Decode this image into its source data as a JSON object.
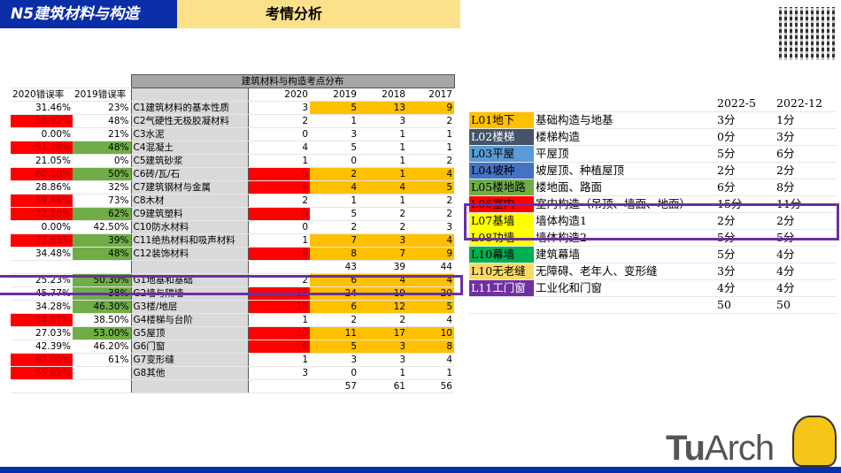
{
  "header": {
    "course": "N5建筑材料与构造",
    "section": "考情分析"
  },
  "logo": "TuArch",
  "left_table": {
    "title": "建筑材料与构造考点分布",
    "rate_headers": [
      "2020错误率",
      "2019错误率"
    ],
    "years": [
      "2020",
      "2019",
      "2018",
      "2017"
    ],
    "rows": [
      {
        "r2020": "31.46%",
        "r2020c": "",
        "r2019": "23%",
        "r2019c": "",
        "name": "C1建筑材料的基本性质",
        "v": [
          "3",
          "5",
          "13",
          "9"
        ],
        "vc": [
          "",
          "org",
          "org",
          "org"
        ]
      },
      {
        "r2020": "58.92%",
        "r2020c": "red",
        "r2019": "48%",
        "r2019c": "",
        "name": "C2气硬性无极胶凝材料",
        "v": [
          "2",
          "1",
          "3",
          "2"
        ],
        "vc": [
          "",
          "",
          "",
          ""
        ]
      },
      {
        "r2020": "0.00%",
        "r2020c": "",
        "r2019": "21%",
        "r2019c": "",
        "name": "C3水泥",
        "v": [
          "0",
          "3",
          "1",
          "1"
        ],
        "vc": [
          "",
          "",
          "",
          ""
        ]
      },
      {
        "r2020": "51.20%",
        "r2020c": "red",
        "r2019": "48%",
        "r2019c": "grn",
        "name": "C4混凝土",
        "v": [
          "4",
          "5",
          "1",
          "1"
        ],
        "vc": [
          "",
          "",
          "",
          ""
        ]
      },
      {
        "r2020": "21.05%",
        "r2020c": "",
        "r2019": "0%",
        "r2019c": "",
        "name": "C5建筑砂浆",
        "v": [
          "1",
          "0",
          "1",
          "2"
        ],
        "vc": [
          "",
          "",
          "",
          ""
        ]
      },
      {
        "r2020": "60.10%",
        "r2020c": "red",
        "r2019": "50%",
        "r2019c": "grn",
        "name": "C6砖/瓦/石",
        "v": [
          "5",
          "2",
          "1",
          "4"
        ],
        "vc": [
          "red",
          "org",
          "org",
          "org"
        ]
      },
      {
        "r2020": "28.86%",
        "r2020c": "",
        "r2019": "32%",
        "r2019c": "",
        "name": "C7建筑钢材与金属",
        "v": [
          "6",
          "4",
          "4",
          "5"
        ],
        "vc": [
          "red",
          "org",
          "org",
          "org"
        ]
      },
      {
        "r2020": "59.46%",
        "r2020c": "red",
        "r2019": "73%",
        "r2019c": "",
        "name": "C8木材",
        "v": [
          "2",
          "1",
          "1",
          "2"
        ],
        "vc": [
          "",
          "",
          "",
          ""
        ]
      },
      {
        "r2020": "72.10%",
        "r2020c": "red",
        "r2019": "62%",
        "r2019c": "grn",
        "name": "C9建筑塑料",
        "v": [
          "5",
          "5",
          "2",
          "2"
        ],
        "vc": [
          "red",
          "",
          "",
          ""
        ]
      },
      {
        "r2020": "0.00%",
        "r2020c": "",
        "r2019": "42.50%",
        "r2019c": "",
        "name": "C10防水材料",
        "v": [
          "0",
          "2",
          "2",
          "3"
        ],
        "vc": [
          "",
          "",
          "",
          ""
        ]
      },
      {
        "r2020": "73.83%",
        "r2020c": "red",
        "r2019": "39%",
        "r2019c": "grn",
        "name": "C11绝热材料和吸声材料",
        "v": [
          "1",
          "7",
          "3",
          "4"
        ],
        "vc": [
          "",
          "org",
          "org",
          "org"
        ]
      },
      {
        "r2020": "34.48%",
        "r2020c": "",
        "r2019": "48%",
        "r2019c": "grn",
        "name": "C12装饰材料",
        "v": [
          "8",
          "8",
          "7",
          "9"
        ],
        "vc": [
          "red",
          "org",
          "org",
          "org"
        ]
      },
      {
        "r2020": "",
        "r2020c": "",
        "r2019": "",
        "r2019c": "",
        "name": "",
        "v": [
          "",
          "43",
          "39",
          "44"
        ],
        "vc": [
          "",
          "",
          "",
          ""
        ]
      },
      {
        "r2020": "25.23%",
        "r2020c": "",
        "r2019": "50.30%",
        "r2019c": "grn",
        "name": "G1地基和基础",
        "v": [
          "2",
          "6",
          "4",
          "4"
        ],
        "vc": [
          "",
          "org",
          "org",
          "org"
        ]
      },
      {
        "r2020": "45.77%",
        "r2020c": "",
        "r2019": "38%",
        "r2019c": "grn",
        "name": "G2墙与隔墙",
        "v": [
          "13",
          "24",
          "19",
          "20"
        ],
        "vc": [
          "red",
          "org",
          "org",
          "org"
        ]
      },
      {
        "r2020": "34.28%",
        "r2020c": "",
        "r2019": "46.30%",
        "r2019c": "grn",
        "name": "G3楼/地层",
        "v": [
          "18",
          "6",
          "12",
          "5"
        ],
        "vc": [
          "red",
          "org",
          "org",
          "org"
        ]
      },
      {
        "r2020": "54.67%",
        "r2020c": "red",
        "r2019": "38.50%",
        "r2019c": "",
        "name": "G4楼梯与台阶",
        "v": [
          "1",
          "2",
          "2",
          "4"
        ],
        "vc": [
          "",
          "",
          "",
          ""
        ]
      },
      {
        "r2020": "27.03%",
        "r2020c": "",
        "r2019": "53.00%",
        "r2019c": "grn",
        "name": "G5屋顶",
        "v": [
          "10",
          "11",
          "17",
          "10"
        ],
        "vc": [
          "red",
          "org",
          "org",
          "org"
        ]
      },
      {
        "r2020": "42.39%",
        "r2020c": "",
        "r2019": "46.20%",
        "r2019c": "",
        "name": "G6门窗",
        "v": [
          "6",
          "5",
          "3",
          "8"
        ],
        "vc": [
          "red",
          "org",
          "org",
          "org"
        ]
      },
      {
        "r2020": "67.00%",
        "r2020c": "red",
        "r2019": "61%",
        "r2019c": "",
        "name": "G7变形缝",
        "v": [
          "1",
          "3",
          "3",
          "4"
        ],
        "vc": [
          "",
          "",
          "",
          ""
        ]
      },
      {
        "r2020": "55.85%",
        "r2020c": "red",
        "r2019": "",
        "r2019c": "",
        "name": "G8其他",
        "v": [
          "3",
          "0",
          "1",
          "1"
        ],
        "vc": [
          "",
          "",
          "",
          ""
        ]
      },
      {
        "r2020": "",
        "r2020c": "",
        "r2019": "",
        "r2019c": "",
        "name": "",
        "v": [
          "",
          "57",
          "61",
          "56"
        ],
        "vc": [
          "",
          "",
          "",
          ""
        ]
      }
    ]
  },
  "right_table": {
    "headers": [
      "2022-5",
      "2022-12"
    ],
    "rows": [
      {
        "code": "L01地下",
        "bg": "#ffc000",
        "fg": "#000000",
        "desc": "基础构造与地基",
        "a": "3分",
        "b": "1分"
      },
      {
        "code": "L02楼梯",
        "bg": "#44546a",
        "fg": "#ffffff",
        "desc": "楼梯构造",
        "a": "0分",
        "b": "3分"
      },
      {
        "code": "L03平屋",
        "bg": "#5b9bd5",
        "fg": "#000000",
        "desc": "平屋顶",
        "a": "5分",
        "b": "6分"
      },
      {
        "code": "L04坡种",
        "bg": "#4472c4",
        "fg": "#000000",
        "desc": "坡屋顶、种植屋顶",
        "a": "2分",
        "b": "2分"
      },
      {
        "code": "L05楼地路",
        "bg": "#70ad47",
        "fg": "#000000",
        "desc": "楼地面、路面",
        "a": "6分",
        "b": "8分"
      },
      {
        "code": "L06室内",
        "bg": "#ff0000",
        "fg": "#000000",
        "desc": "室内构造（吊顶、墙面、地面）",
        "a": "15分",
        "b": "11分"
      },
      {
        "code": "L07基墙",
        "bg": "#ffff00",
        "fg": "#000000",
        "desc": "墙体构造1",
        "a": "2分",
        "b": "2分"
      },
      {
        "code": "L08功墙",
        "bg": "#ffff00",
        "fg": "#000000",
        "desc": "墙体构造2",
        "a": "5分",
        "b": "5分"
      },
      {
        "code": "L10幕墙",
        "bg": "#00b050",
        "fg": "#000000",
        "desc": "建筑幕墙",
        "a": "5分",
        "b": "4分"
      },
      {
        "code": "L10无老缝",
        "bg": "#ffd966",
        "fg": "#000000",
        "desc": "无障碍、老年人、变形缝",
        "a": "3分",
        "b": "4分"
      },
      {
        "code": "L11工门窗",
        "bg": "#7030a0",
        "fg": "#ffffff",
        "desc": "工业化和门窗",
        "a": "4分",
        "b": "4分"
      },
      {
        "code": "",
        "bg": "",
        "fg": "",
        "desc": "",
        "a": "50",
        "b": "50"
      }
    ]
  }
}
